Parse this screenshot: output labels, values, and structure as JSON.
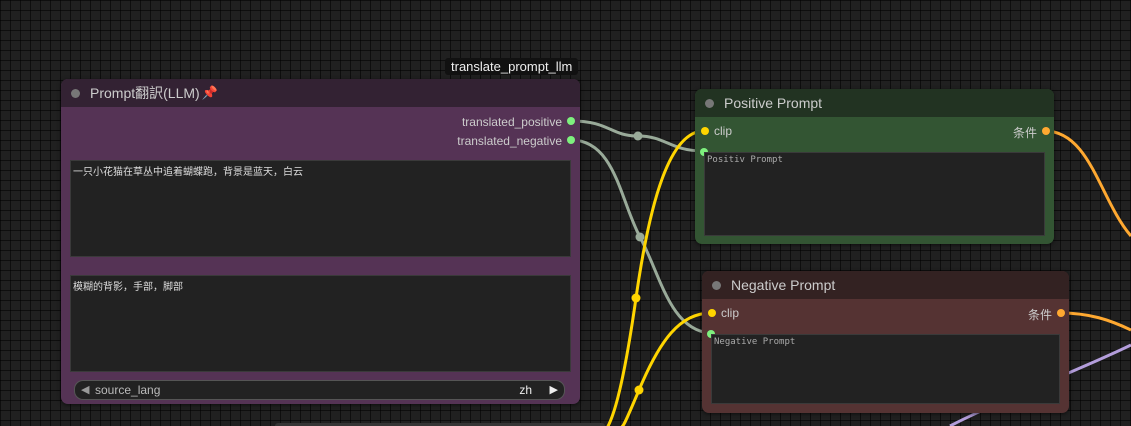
{
  "group_badge": "translate_prompt_llm",
  "nodes": {
    "translate": {
      "title": "Prompt翻訳(LLM)",
      "pin_icon": "pushpin-icon",
      "outputs": [
        "translated_positive",
        "translated_negative"
      ],
      "positive_text": "一只小花猫在草丛中追着蝴蝶跑，背景是蓝天，白云",
      "negative_text": "模糊的背影，手部，脚部",
      "widget": {
        "label": "source_lang",
        "value": "zh"
      }
    },
    "positive": {
      "title": "Positive Prompt",
      "input": "clip",
      "output": "条件",
      "placeholder": "Positiv Prompt"
    },
    "negative": {
      "title": "Negative Prompt",
      "input": "clip",
      "output": "条件",
      "placeholder": "Negative Prompt"
    }
  },
  "colors": {
    "translate_body": "#553355",
    "translate_title": "#332233",
    "positive_body": "#335533",
    "positive_title": "#223322",
    "negative_body": "#553333",
    "negative_title": "#332222",
    "string_link": "#99aa99",
    "clip_link": "#ffd500",
    "conditioning_link": "#ffa931",
    "other_link": "#b39ddb"
  }
}
